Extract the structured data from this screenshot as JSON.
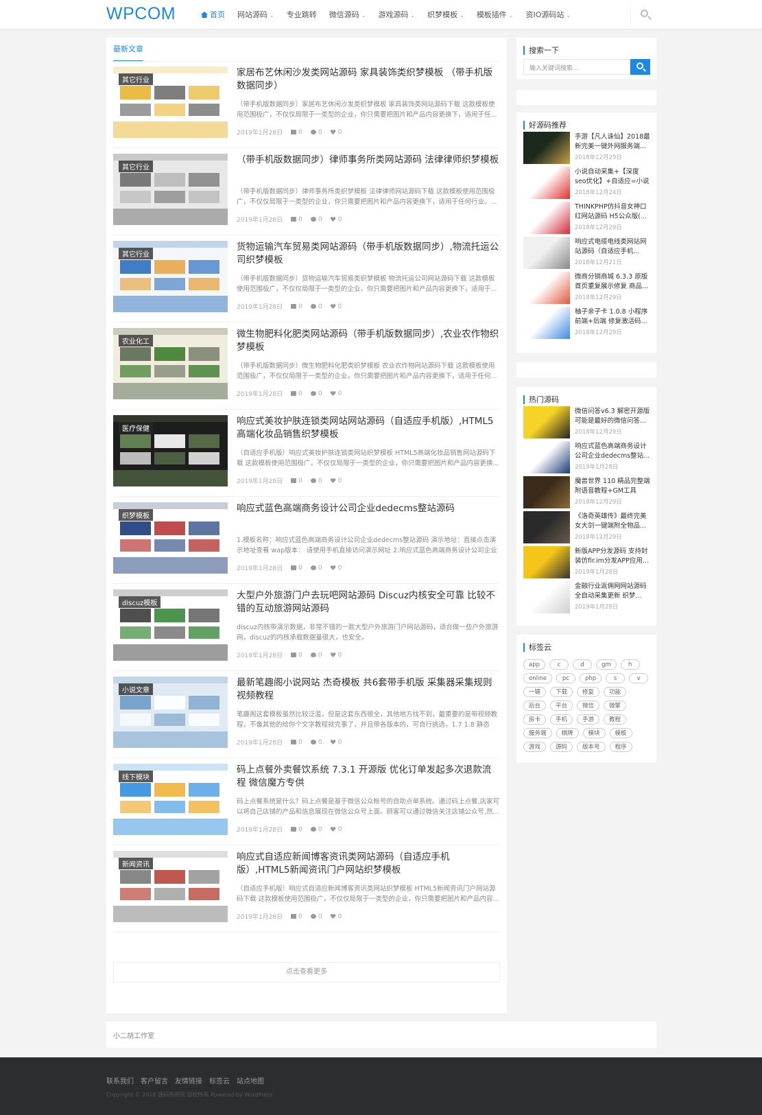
{
  "header": {
    "logo": "WPCOM",
    "nav": [
      {
        "label": "首页",
        "active": true,
        "dropdown": false
      },
      {
        "label": "网站源码",
        "active": false,
        "dropdown": true
      },
      {
        "label": "专业跳转",
        "active": false,
        "dropdown": false
      },
      {
        "label": "微信源码",
        "active": false,
        "dropdown": true
      },
      {
        "label": "游戏源码",
        "active": false,
        "dropdown": true
      },
      {
        "label": "织梦模板",
        "active": false,
        "dropdown": true
      },
      {
        "label": "模板插件",
        "active": false,
        "dropdown": true
      },
      {
        "label": "资IO源码站",
        "active": false,
        "dropdown": true
      }
    ]
  },
  "main": {
    "tab": "最新文章",
    "load_more": "点击查看更多",
    "articles": [
      {
        "category": "其它行业",
        "title": "家居布艺休闲沙发类网站源码 家具装饰类织梦模板 （带手机版数据同步）",
        "excerpt": "（带手机版数据同步）家居布艺休闲沙发类织梦模板 家具装饰类网站源码下载 这款模板使用范围极广，不仅仅局限于一类型的企业，你只需要把图片和产品内容更换下，适用于任...",
        "date": "2019年1月28日",
        "likes": "0",
        "comments": "0",
        "favs": "0",
        "palette": [
          "#ffffff",
          "#e9b530",
          "#707070"
        ]
      },
      {
        "category": "其它行业",
        "title": "（带手机版数据同步）律师事务所类网站源码 法律律师织梦模板",
        "excerpt": "（带手机版数据同步）律师事务所类织梦模板 法律律师网站源码下载 这款模板使用范围极广，不仅仅局限于一类型的企业，你只需要把图片和产品内容更换下，适用于任何行业。...",
        "date": "2019年1月28日",
        "likes": "0",
        "comments": "0",
        "favs": "0",
        "palette": [
          "#e8e8e8",
          "#6d6d6d",
          "#b9b9b9"
        ]
      },
      {
        "category": "其它行业",
        "title": "货物运输汽车贸易类网站源码（带手机版数据同步）,物流托运公司织梦模板",
        "excerpt": "（带手机版数据同步）货物运输汽车贸易类织梦模板 物流托运公司网站源码下载 这款模板使用范围极广，不仅仅局限于一类型的企业，你只需要把图片和产品内容更换下，适用于...",
        "date": "2019年1月28日",
        "likes": "0",
        "comments": "0",
        "favs": "0",
        "palette": [
          "#f5f6f8",
          "#2d6fc0",
          "#e7a84b"
        ]
      },
      {
        "category": "农业化工",
        "title": "微生物肥料化肥类网站源码（带手机版数据同步）,农业农作物织梦模板",
        "excerpt": "（带手机版数据同步）微生物肥料化肥类织梦模板 农业农作物网站源码下载 这款模板使用范围极广，不仅仅局限于一类型的企业，你只需要把图片和产品内容更换下，适用于任何...",
        "date": "2019年1月28日",
        "likes": "0",
        "comments": "0",
        "favs": "0",
        "palette": [
          "#f1ece0",
          "#5c6b53",
          "#3b7d2a"
        ]
      },
      {
        "category": "医疗保健",
        "title": "响应式美妆护肤连锁类网站网站源码（自适应手机版）,HTML5高端化妆品销售织梦模板",
        "excerpt": "（自适应手机版）响应式美妆护肤连锁类网站织梦模板 HTML5高端化妆品销售网站源码下载 这款模板使用范围极广，不仅仅局限于一类型的企业，你只需要把图片和产品内容更换...",
        "date": "2019年1月28日",
        "likes": "0",
        "comments": "0",
        "favs": "0",
        "palette": [
          "#1d1d1d",
          "#6c8c5a",
          "#ffffff"
        ]
      },
      {
        "category": "织梦模板",
        "title": "响应式蓝色高端商务设计公司企业dedecms整站源码",
        "excerpt": "1.模板名称：响应式蓝色高端商务设计公司企业dedecms整站源码 演示地址：直接点击演示地址查看 wap版本： 请使用手机直接访问演示网址 2.响应式蓝色高端商务设计公司企业de...",
        "date": "2019年1月28日",
        "likes": "0",
        "comments": "0",
        "favs": "0",
        "palette": [
          "#ffffff",
          "#1a3a7a",
          "#b83a3a"
        ]
      },
      {
        "category": "discuz模板",
        "title": "大型户外旅游门户去玩吧网站源码 Discuz内核安全可靠 比较不错的互动旅游网站源码",
        "excerpt": "discuz内核带演示数据，非常不错的一款大型户外旅游门户网站源码，适合做一些户外旅游网，discuz的内核承载数据量很大，也安全。",
        "date": "2019年1月28日",
        "likes": "0",
        "comments": "0",
        "favs": "0",
        "palette": [
          "#ffffff",
          "#3c3c3c",
          "#3a8a3a"
        ]
      },
      {
        "category": "小说文章",
        "title": "最新笔趣阁小说网站 杰奇模板 共6套带手机版 采集器采集规则 视频教程",
        "excerpt": "笔趣阁这套模板虽然比较泛滥，但是这套东西很全，其他地方找不到，最重要的是带视频教程，不像其他的给你个文字教程就完事了，并且带各版本的，可自行挑选，1.7 1.8 静态 伪...",
        "date": "2019年1月28日",
        "likes": "0",
        "comments": "0",
        "favs": "0",
        "palette": [
          "#dfeaf3",
          "#6f9bc8",
          "#ffffff"
        ]
      },
      {
        "category": "线下模块",
        "title": "码上点餐外卖餐饮系统 7.3.1 开源版 优化订单发起多次退款流程 微信魔方专供",
        "excerpt": "码上点餐系统是什么？码上点餐是基于微信公众帐号的自助点单系统。通过码上点餐,店家可以将自己店铺的产品和信息展现在微信公众号上面。顾客可以通过微信关注店铺公众号,然...",
        "date": "2019年1月28日",
        "likes": "0",
        "comments": "0",
        "favs": "0",
        "palette": [
          "#ffffff",
          "#2f8fdd",
          "#f0b23a"
        ]
      },
      {
        "category": "新闻资讯",
        "title": "响应式自适应新闻博客资讯类网站源码（自适应手机版）,HTML5新闻资讯门户网站织梦模板",
        "excerpt": "（自适应手机版）响应式自适应新闻博客资讯类网站织梦模板 HTML5新闻资讯门户网站源码下载 这款模板使用范围极广，不仅仅局限于一类型的企业，你只需要把图片和产品内容...",
        "date": "2019年1月28日",
        "likes": "0",
        "comments": "0",
        "favs": "0",
        "palette": [
          "#ffffff",
          "#7a7a7a",
          "#b8473b"
        ]
      }
    ]
  },
  "sidebar": {
    "search": {
      "title": "搜索一下",
      "placeholder": "输入关键词搜索..."
    },
    "recommended": {
      "title": "好源码推荐",
      "items": [
        {
          "title": "手游【凡人诛仙】2018最新完美一键外网服务端...",
          "date": "2018年12月29日",
          "palette": [
            "#1c2a1c",
            "#c9a14a"
          ]
        },
        {
          "title": "小说自动采集+【深度seo优化】+自适应=小说网...",
          "date": "2018年12月24日",
          "palette": [
            "#ffffff",
            "#e03030"
          ]
        },
        {
          "title": "THINKPHP仿抖音女神口红网站源码 H5公众版(...",
          "date": "2018年12月29日",
          "palette": [
            "#ffffff",
            "#d02a3a"
          ]
        },
        {
          "title": "响应式电缆电线类网站网站源码（自适应手机...",
          "date": "2018年12月21日",
          "palette": [
            "#f0f0f0",
            "#8a8a8a"
          ]
        },
        {
          "title": "微商分销商城 6.3.3 原版首页重复展示修复 商品...",
          "date": "2018年12月29日",
          "palette": [
            "#ffffff",
            "#e0583a"
          ]
        },
        {
          "title": "柚子亲子卡 1.0.8 小程序前端+后端 修复激活码...",
          "date": "2018年12月29日",
          "palette": [
            "#ffffff",
            "#3a8ae0"
          ]
        }
      ]
    },
    "hot": {
      "title": "热门源码",
      "items": [
        {
          "title": "微信问答v6.3 解密开源版 可能是最好的微信问答...",
          "date": "2018年12月29日",
          "palette": [
            "#f5d327",
            "#222222"
          ]
        },
        {
          "title": "响应式蓝色高端商务设计公司企业dedecms整站...",
          "date": "2019年1月28日",
          "palette": [
            "#ffffff",
            "#1a3a7a"
          ]
        },
        {
          "title": "魔兽世界 110 精品完整端附语音教程+GM工具 最...",
          "date": "2018年12月29日",
          "palette": [
            "#3a2a1a",
            "#8a6a3a"
          ]
        },
        {
          "title": "《洛奇英雄传》最终完美女大剑一键端附全物品...",
          "date": "2018年12月29日",
          "palette": [
            "#2a2a2a",
            "#6a5a4a"
          ]
        },
        {
          "title": "新版APP分发源码 支持封装仿fir.im分发APP应用...",
          "date": "2019年1月28日",
          "palette": [
            "#f5c518",
            "#333333"
          ]
        },
        {
          "title": "金融行业返佣网网站源码全自动采集更新 织梦...",
          "date": "2019年1月28日",
          "palette": [
            "#ffffff",
            "#d0d0d0"
          ]
        }
      ]
    },
    "tagcloud": {
      "title": "标签云",
      "tags": [
        "app",
        "c",
        "d",
        "gm",
        "h",
        "online",
        "pc",
        "php",
        "s",
        "v",
        "一键",
        "下载",
        "修复",
        "功能",
        "后台",
        "平台",
        "微信",
        "微擎",
        "房卡",
        "手机",
        "手游",
        "教程",
        "服务端",
        "棋牌",
        "模块",
        "模板",
        "游戏",
        "源码",
        "版本号",
        "程序"
      ]
    }
  },
  "studio": "小二胡工作室",
  "footer": {
    "links": [
      "联系我们",
      "客户留言",
      "友情链接",
      "标签云",
      "站点地图"
    ],
    "copyright": "Copyright © 2018 源码热带网 版权所有 Powered by WordPress"
  }
}
